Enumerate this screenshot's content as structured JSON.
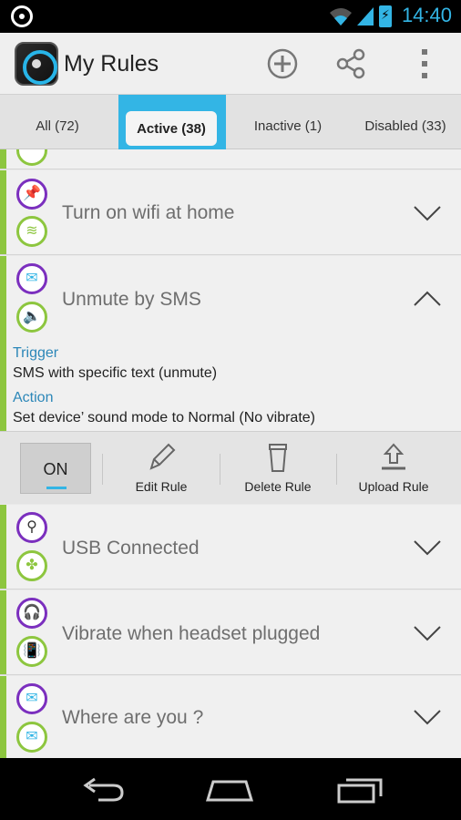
{
  "status_bar": {
    "time": "14:40"
  },
  "app": {
    "title": "My Rules"
  },
  "tabs": [
    {
      "label": "All (72)"
    },
    {
      "label": "Active (38)"
    },
    {
      "label": "Inactive (1)"
    },
    {
      "label": "Disabled (33)"
    }
  ],
  "rules": [
    {
      "name": "Turn on wifi at home",
      "trigger_icon": "pushpin-icon",
      "action_icon": "wifi-icon"
    },
    {
      "name": "Unmute by SMS",
      "trigger_icon": "sms-icon",
      "action_icon": "speaker-icon"
    },
    {
      "name": "USB Connected",
      "trigger_icon": "usb-icon",
      "action_icon": "apps-icon"
    },
    {
      "name": "Vibrate when headset plugged",
      "trigger_icon": "headset-icon",
      "action_icon": "vibrate-icon"
    },
    {
      "name": "Where are you ?",
      "trigger_icon": "sms-icon",
      "action_icon": "sms-reply-icon"
    }
  ],
  "expanded_rule": {
    "trigger_label": "Trigger",
    "trigger_text": "SMS with specific text (unmute)",
    "action_label": "Action",
    "action_text": "Set device’ sound mode to Normal (No vibrate)"
  },
  "rule_actions": {
    "on_label": "ON",
    "edit_label": "Edit Rule",
    "delete_label": "Delete Rule",
    "upload_label": "Upload Rule"
  },
  "colors": {
    "accent": "#33b5e5",
    "rule_bar": "#8dc63f",
    "trigger_ring": "#7b2fbe",
    "section_label": "#2c87b8"
  }
}
